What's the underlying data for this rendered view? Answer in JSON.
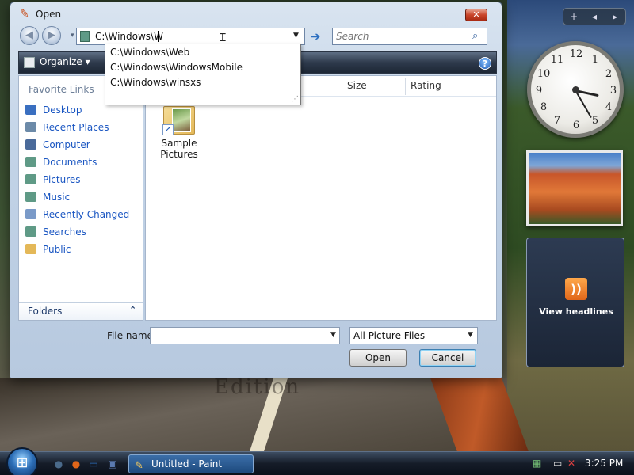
{
  "dialog": {
    "title": "Open",
    "close_glyph": "✕"
  },
  "nav": {
    "back_glyph": "◀",
    "forward_glyph": "▶",
    "dropdown_glyph": "▾"
  },
  "address": {
    "value": "C:\\Windows\\W",
    "dropdown_glyph": "▼",
    "go_glyph": "➔"
  },
  "search": {
    "placeholder": "Search",
    "icon_glyph": "⌕"
  },
  "toolbar": {
    "organize_label": "Organize",
    "organize_glyph": "▾",
    "help_glyph": "?"
  },
  "autocomplete": {
    "items": [
      "C:\\Windows\\Web",
      "C:\\Windows\\WindowsMobile",
      "C:\\Windows\\winsxs"
    ],
    "grip_glyph": "⋰"
  },
  "favorites": {
    "title": "Favorite Links",
    "items": [
      {
        "label": "Desktop",
        "icon": "desktop-icon",
        "color": "#3a6fc0"
      },
      {
        "label": "Recent Places",
        "icon": "recent-places-icon",
        "color": "#6c8aa8"
      },
      {
        "label": "Computer",
        "icon": "computer-icon",
        "color": "#4a6a9a"
      },
      {
        "label": "Documents",
        "icon": "documents-icon",
        "color": "#5f9a86"
      },
      {
        "label": "Pictures",
        "icon": "pictures-icon",
        "color": "#5f9a86"
      },
      {
        "label": "Music",
        "icon": "music-icon",
        "color": "#5f9a86"
      },
      {
        "label": "Recently Changed",
        "icon": "recently-changed-icon",
        "color": "#7a9ac8"
      },
      {
        "label": "Searches",
        "icon": "searches-icon",
        "color": "#5f9a86"
      },
      {
        "label": "Public",
        "icon": "public-folder-icon",
        "color": "#e4b858"
      }
    ]
  },
  "folders": {
    "label": "Folders",
    "chevron": "⌃"
  },
  "columns": {
    "tags": "ngs",
    "size": "Size",
    "rating": "Rating"
  },
  "files": [
    {
      "label": "Sample Pictures",
      "icon": "folder-shortcut-icon",
      "shortcut_glyph": "↗"
    }
  ],
  "footer": {
    "file_name_label": "File name:",
    "file_name_value": "",
    "file_name_dropdown_glyph": "▼",
    "filter_value": "All Picture Files",
    "filter_dropdown_glyph": "▼",
    "open_label": "Open",
    "cancel_label": "Cancel"
  },
  "gadgets": {
    "bar_add": "+",
    "bar_prev": "◂",
    "bar_next": "▸",
    "clock_numbers": [
      "12",
      "1",
      "2",
      "3",
      "4",
      "5",
      "6",
      "7",
      "8",
      "9",
      "10",
      "11"
    ],
    "feed_icon_glyph": "))",
    "feed_label": "View headlines"
  },
  "wallpaper": {
    "watermark": "Edition"
  },
  "taskbar": {
    "start_glyph": "⊞",
    "quick_launch": [
      {
        "icon": "show-desktop-icon",
        "glyph": "●",
        "color": "#4a6a8a"
      },
      {
        "icon": "firefox-icon",
        "glyph": "●",
        "color": "#e0661a"
      },
      {
        "icon": "desktop-shortcut-icon",
        "glyph": "▭",
        "color": "#2c6fc0"
      },
      {
        "icon": "switch-windows-icon",
        "glyph": "▣",
        "color": "#5a7ab0"
      }
    ],
    "task_label": "Untitled - Paint",
    "task_glyph": "✎",
    "time": "3:25 PM",
    "tray_icons": [
      {
        "icon": "network-icon",
        "glyph": "▦",
        "color": "#7ac87a"
      },
      {
        "icon": "monitor-alert-icon",
        "glyph": "▭",
        "color": "#e0e0e0"
      },
      {
        "icon": "volume-mute-icon",
        "glyph": "✕",
        "color": "#e04040"
      }
    ]
  }
}
